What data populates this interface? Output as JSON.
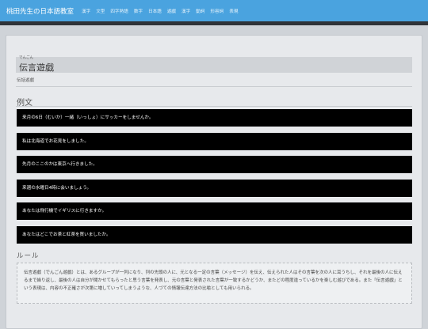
{
  "header": {
    "brand": "桃田先生の日本語教室",
    "nav": [
      "漢字",
      "文型",
      "四字熟語",
      "数字",
      "日本語",
      "遊戯",
      "漢字",
      "動詞",
      "形容詞",
      "表現"
    ]
  },
  "page": {
    "reading": "でんごん",
    "title": "伝言遊戯",
    "subtitle": "伝話遊戯"
  },
  "examples": {
    "heading": "例文",
    "items": [
      "来月の6日（むいか）一緒（いっしょ）にサッカーをしませんか。",
      "私は北海道でお花見をしました。",
      "先月のここのかは東京へ行きました。",
      "来週の水曜日4時に会いましょう。",
      "あなたは飛行機でイギリスに行きますか。",
      "あなたはどこでお茶と紅茶を買いましたか。"
    ]
  },
  "rules": {
    "heading": "ルール",
    "text": "伝言遊戯（でんごん遊戯）とは、あるグループが一列になり、列の先頭の人に、元となる一定の言葉（メッセージ）を伝え、伝えられた人はその言葉を次の人に耳うちし、それを最後の人に伝えるまで繰り返し、最後の人は自分が聞かせてもらったと思う言葉を発表し、元の言葉と発表された言葉が一致するかどうか、またどの程度違っているかを楽しむ遊びである。また「伝言遊戯」という表現は、内容の不正確さが次第に増していってしまうような、人づての情報伝達方法の比喩としても用いられる。"
  },
  "colors": {
    "topbar": "#4aa3df",
    "example_bg": "#000000"
  }
}
